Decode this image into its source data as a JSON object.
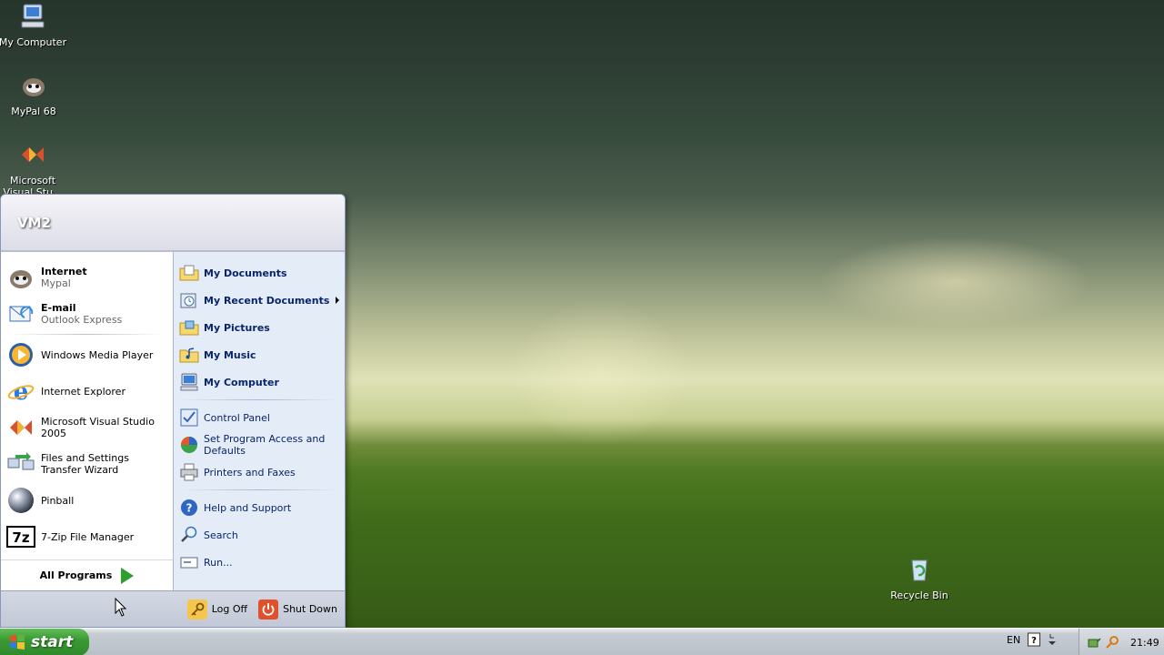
{
  "desktop": {
    "icons": [
      {
        "label": "My Computer",
        "icon": "my-computer-icon"
      },
      {
        "label": "MyPal 68",
        "icon": "mypal-icon"
      },
      {
        "label": "Microsoft Visual Stu...",
        "icon": "visual-studio-icon"
      },
      {
        "label": "Recycle Bin",
        "icon": "recycle-bin-icon"
      }
    ]
  },
  "start_menu": {
    "user": "VM2",
    "pinned": [
      {
        "label": "Internet",
        "sub": "Mypal",
        "icon": "mypal-icon"
      },
      {
        "label": "E-mail",
        "sub": "Outlook Express",
        "icon": "outlook-express-icon"
      }
    ],
    "recent": [
      {
        "label": "Windows Media Player",
        "icon": "media-player-icon"
      },
      {
        "label": "Internet Explorer",
        "icon": "internet-explorer-icon"
      },
      {
        "label": "Microsoft Visual Studio 2005",
        "icon": "visual-studio-icon"
      },
      {
        "label": "Files and Settings Transfer Wizard",
        "icon": "transfer-wizard-icon"
      },
      {
        "label": "Pinball",
        "icon": "pinball-icon"
      },
      {
        "label": "7-Zip File Manager",
        "icon": "7zip-icon"
      }
    ],
    "all_programs": "All Programs",
    "places": [
      {
        "label": "My Documents",
        "icon": "folder-documents-icon"
      },
      {
        "label": "My Recent Documents",
        "icon": "recent-documents-icon"
      },
      {
        "label": "My Pictures",
        "icon": "folder-pictures-icon"
      },
      {
        "label": "My Music",
        "icon": "folder-music-icon"
      },
      {
        "label": "My Computer",
        "icon": "my-computer-icon"
      }
    ],
    "settings": [
      {
        "label": "Control Panel",
        "icon": "control-panel-icon"
      },
      {
        "label": "Set Program Access and Defaults",
        "icon": "program-defaults-icon"
      },
      {
        "label": "Printers and Faxes",
        "icon": "printer-icon"
      }
    ],
    "help": [
      {
        "label": "Help and Support",
        "icon": "help-icon"
      },
      {
        "label": "Search",
        "icon": "search-icon"
      },
      {
        "label": "Run...",
        "icon": "run-icon"
      }
    ],
    "log_off": "Log Off",
    "shut_down": "Shut Down"
  },
  "taskbar": {
    "start_label": "start",
    "language": "EN",
    "clock": "21:49"
  }
}
